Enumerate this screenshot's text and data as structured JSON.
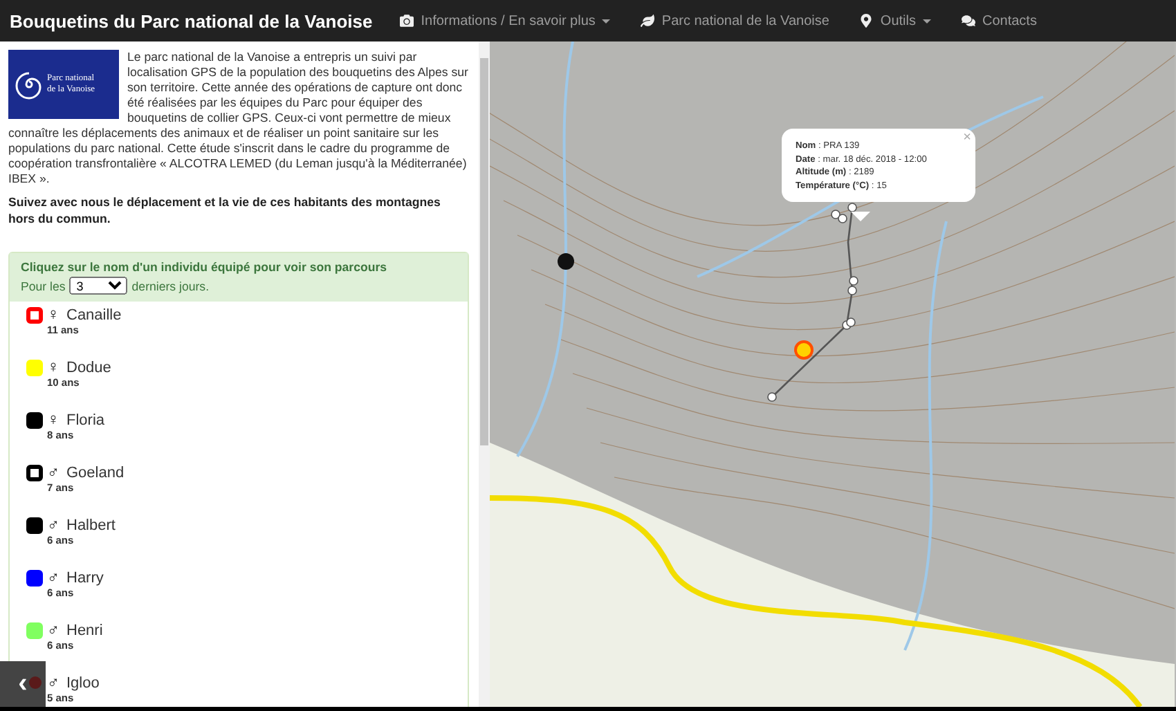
{
  "navbar": {
    "brand": "Bouquetins du Parc national de la Vanoise",
    "items": [
      {
        "kind": "camera",
        "label": "Informations / En savoir plus",
        "dropdown": true
      },
      {
        "kind": "leaf",
        "label": "Parc national de la Vanoise",
        "dropdown": false
      },
      {
        "kind": "pin",
        "label": "Outils",
        "dropdown": true
      },
      {
        "kind": "chat",
        "label": "Contacts",
        "dropdown": false
      }
    ]
  },
  "intro": {
    "logo_lines": [
      "Parc national",
      "de la Vanoise"
    ],
    "text_beside_logo": "Le parc national de la Vanoise a entrepris un suivi par localisation GPS de la population des bouquetins des Alpes sur son territoire. Cette année des opérations de capture ont donc été réalisées par les équipes du Parc pour équiper des bouquetins de collier GPS. Ceux-ci vont permettre de mieux",
    "text_below": "connaître les déplacements des animaux et de réaliser un point sanitaire sur les populations du parc national. Cette étude s'inscrit dans le cadre du programme de coopération transfrontalière « ALCOTRA LEMED (du Leman jusqu'à la Méditerranée) IBEX ».",
    "bold_text": "Suivez avec nous le déplacement et la vie de ces habitants des montagnes hors du commun."
  },
  "panel": {
    "heading": "Cliquez sur le nom d'un individu équipé pour voir son parcours",
    "days_prefix": "Pour les",
    "days_value": "3",
    "days_suffix": "derniers jours."
  },
  "individuals": [
    {
      "name": "Canaille",
      "sex": "♀",
      "age": "11 ans",
      "kind": "ring",
      "color": "#ff0000"
    },
    {
      "name": "Dodue",
      "sex": "♀",
      "age": "10 ans",
      "kind": "square",
      "color": "#ffff00"
    },
    {
      "name": "Floria",
      "sex": "♀",
      "age": "8 ans",
      "kind": "square",
      "color": "#000000"
    },
    {
      "name": "Goeland",
      "sex": "♂",
      "age": "7 ans",
      "kind": "ring",
      "color": "#000000"
    },
    {
      "name": "Halbert",
      "sex": "♂",
      "age": "6 ans",
      "kind": "square",
      "color": "#000000"
    },
    {
      "name": "Harry",
      "sex": "♂",
      "age": "6 ans",
      "kind": "square",
      "color": "#0000ff"
    },
    {
      "name": "Henri",
      "sex": "♂",
      "age": "6 ans",
      "kind": "square",
      "color": "#80ff60"
    },
    {
      "name": "Igloo",
      "sex": "♂",
      "age": "5 ans",
      "kind": "dot",
      "color": "#5a1a1a"
    }
  ],
  "back_button": {
    "label": "‹"
  },
  "popup": {
    "close": "×",
    "lines": [
      "**Nom** : PRA 139",
      "**Date** : mar. 18 déc. 2018 - 12:00",
      "**Altitude (m)** : 2189",
      "**Température (°C)** : 15"
    ]
  }
}
